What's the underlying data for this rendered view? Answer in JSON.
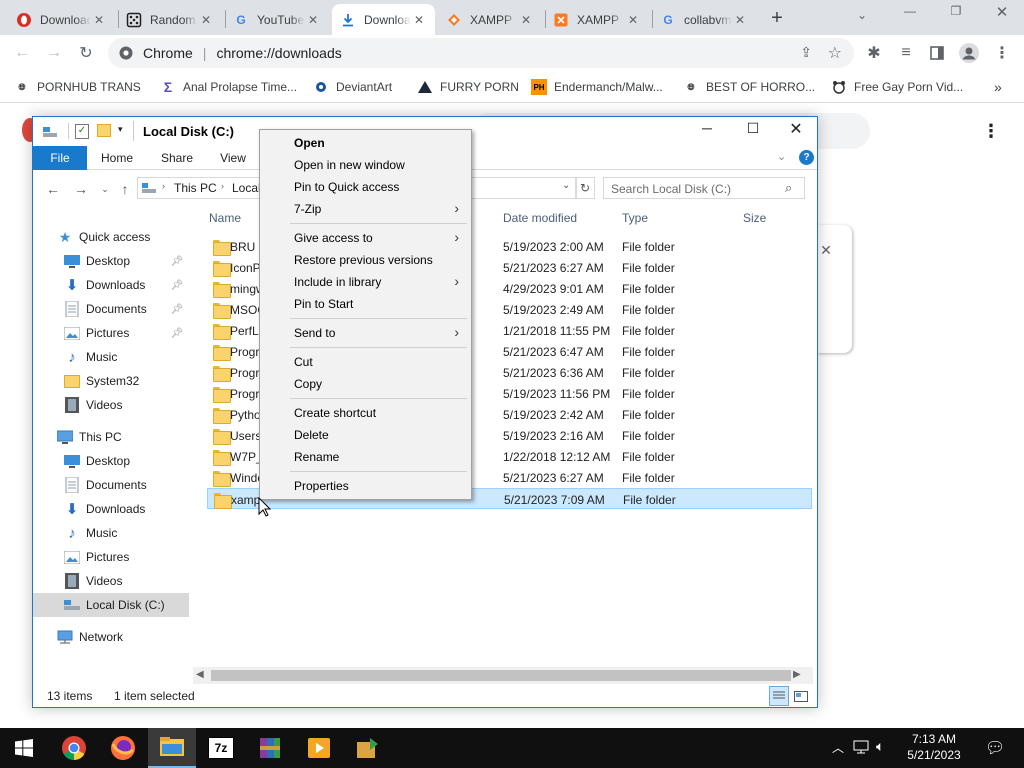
{
  "browser": {
    "tabs": [
      {
        "title": "Downloads",
        "icon": "opera-icon",
        "color": "#d93025"
      },
      {
        "title": "Random",
        "icon": "dice-icon",
        "color": "#202124"
      },
      {
        "title": "YouTube",
        "icon": "google-icon",
        "color": "#4285f4"
      },
      {
        "title": "Downloads",
        "icon": "download-icon",
        "color": "#1a73e8",
        "active": true
      },
      {
        "title": "XAMPP",
        "icon": "xampp-diamond-icon",
        "color": "#fb7a24"
      },
      {
        "title": "XAMPP",
        "icon": "xampp-icon",
        "color": "#fb7a24"
      },
      {
        "title": "collabvm",
        "icon": "google-icon",
        "color": "#4285f4"
      }
    ],
    "new_tab_symbol": "+",
    "omnibox": {
      "label": "Chrome",
      "url": "chrome://downloads"
    },
    "bookmarks": [
      {
        "label": "PORNHUB TRANS",
        "icon": "globe-icon"
      },
      {
        "label": "Anal Prolapse Time...",
        "icon": "sigma-icon"
      },
      {
        "label": "DeviantArt",
        "icon": "deviantart-icon"
      },
      {
        "label": "FURRY PORN",
        "icon": "furaffinity-icon"
      },
      {
        "label": "Endermanch/Malw...",
        "icon": "ph-icon",
        "icon_text": "PH"
      },
      {
        "label": "BEST OF HORRO...",
        "icon": "globe-icon"
      },
      {
        "label": "Free Gay Porn Vid...",
        "icon": "bear-icon"
      }
    ],
    "bookmarks_overflow": "»"
  },
  "explorer": {
    "title": "Local Disk (C:)",
    "ribbon_tabs": [
      "File",
      "Home",
      "Share",
      "View"
    ],
    "breadcrumb": [
      "This PC",
      "Local"
    ],
    "search_placeholder": "Search Local Disk (C:)",
    "sidebar": [
      {
        "label": "Quick access",
        "icon": "star-icon",
        "level": 0
      },
      {
        "label": "Desktop",
        "icon": "desktop-icon",
        "level": 1,
        "pinned": true
      },
      {
        "label": "Downloads",
        "icon": "downloads-icon",
        "level": 1,
        "pinned": true
      },
      {
        "label": "Documents",
        "icon": "documents-icon",
        "level": 1,
        "pinned": true
      },
      {
        "label": "Pictures",
        "icon": "pictures-icon",
        "level": 1,
        "pinned": true
      },
      {
        "label": "Music",
        "icon": "music-icon",
        "level": 1
      },
      {
        "label": "System32",
        "icon": "folder-icon",
        "level": 1
      },
      {
        "label": "Videos",
        "icon": "videos-icon",
        "level": 1
      },
      {
        "label": "This PC",
        "icon": "computer-icon",
        "level": 0
      },
      {
        "label": "Desktop",
        "icon": "desktop-icon",
        "level": 1
      },
      {
        "label": "Documents",
        "icon": "documents-icon",
        "level": 1
      },
      {
        "label": "Downloads",
        "icon": "downloads-icon",
        "level": 1
      },
      {
        "label": "Music",
        "icon": "music-icon",
        "level": 1
      },
      {
        "label": "Pictures",
        "icon": "pictures-icon",
        "level": 1
      },
      {
        "label": "Videos",
        "icon": "videos-icon",
        "level": 1
      },
      {
        "label": "Local Disk (C:)",
        "icon": "drive-icon",
        "level": 1,
        "selected": true
      },
      {
        "label": "Network",
        "icon": "network-icon",
        "level": 0
      }
    ],
    "columns": [
      "Name",
      "Date modified",
      "Type",
      "Size"
    ],
    "rows": [
      {
        "name": "BRU",
        "date": "5/19/2023 2:00 AM",
        "type": "File folder"
      },
      {
        "name": "IconPa",
        "date": "5/21/2023 6:27 AM",
        "type": "File folder"
      },
      {
        "name": "mingw",
        "date": "4/29/2023 9:01 AM",
        "type": "File folder"
      },
      {
        "name": "MSOC",
        "date": "5/19/2023 2:49 AM",
        "type": "File folder"
      },
      {
        "name": "PerfLo",
        "date": "1/21/2018 11:55 PM",
        "type": "File folder"
      },
      {
        "name": "Progra",
        "date": "5/21/2023 6:47 AM",
        "type": "File folder"
      },
      {
        "name": "Progra",
        "date": "5/21/2023 6:36 AM",
        "type": "File folder"
      },
      {
        "name": "Progra",
        "date": "5/19/2023 11:56 PM",
        "type": "File folder"
      },
      {
        "name": "Pytho",
        "date": "5/19/2023 2:42 AM",
        "type": "File folder"
      },
      {
        "name": "Users",
        "date": "5/19/2023 2:16 AM",
        "type": "File folder"
      },
      {
        "name": "W7P_I",
        "date": "1/22/2018 12:12 AM",
        "type": "File folder"
      },
      {
        "name": "Windo",
        "date": "5/21/2023 6:27 AM",
        "type": "File folder"
      },
      {
        "name": "xamp",
        "date": "5/21/2023 7:09 AM",
        "type": "File folder",
        "selected": true
      }
    ],
    "status": {
      "count": "13 items",
      "selection": "1 item selected"
    }
  },
  "context_menu": {
    "items": [
      {
        "label": "Open",
        "bold": true
      },
      {
        "label": "Open in new window"
      },
      {
        "label": "Pin to Quick access"
      },
      {
        "label": "7-Zip",
        "submenu": true
      },
      {
        "sep": true
      },
      {
        "label": "Give access to",
        "submenu": true
      },
      {
        "label": "Restore previous versions"
      },
      {
        "label": "Include in library",
        "submenu": true
      },
      {
        "label": "Pin to Start"
      },
      {
        "sep": true
      },
      {
        "label": "Send to",
        "submenu": true
      },
      {
        "sep": true
      },
      {
        "label": "Cut"
      },
      {
        "label": "Copy"
      },
      {
        "sep": true
      },
      {
        "label": "Create shortcut"
      },
      {
        "label": "Delete"
      },
      {
        "label": "Rename"
      },
      {
        "sep": true
      },
      {
        "label": "Properties"
      }
    ]
  },
  "taskbar": {
    "apps": [
      "windows-start-icon",
      "chrome-icon",
      "firefox-icon",
      "file-explorer-icon",
      "7zip-icon",
      "winrar-icon",
      "media-player-icon",
      "install-icon"
    ],
    "sevenzip_label": "7z",
    "time": "7:13 AM",
    "date": "5/21/2023"
  }
}
